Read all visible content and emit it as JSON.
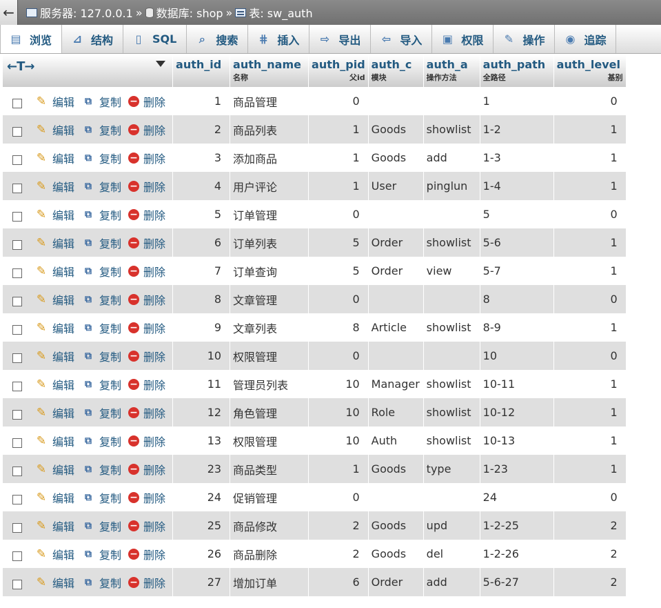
{
  "breadcrumb": {
    "back": "←",
    "server_label": "服务器: 127.0.0.1",
    "sep": "»",
    "db_label": "数据库: shop",
    "table_label": "表: sw_auth"
  },
  "tabs": [
    {
      "label": "浏览",
      "icon": "browse-icon",
      "glyph": "▤"
    },
    {
      "label": "结构",
      "icon": "structure-icon",
      "glyph": "⊿"
    },
    {
      "label": "SQL",
      "icon": "sql-icon",
      "glyph": "▯"
    },
    {
      "label": "搜索",
      "icon": "search-icon",
      "glyph": "⌕"
    },
    {
      "label": "插入",
      "icon": "insert-icon",
      "glyph": "⋕"
    },
    {
      "label": "导出",
      "icon": "export-icon",
      "glyph": "⇨"
    },
    {
      "label": "导入",
      "icon": "import-icon",
      "glyph": "⇦"
    },
    {
      "label": "权限",
      "icon": "privileges-icon",
      "glyph": "▣"
    },
    {
      "label": "操作",
      "icon": "operations-icon",
      "glyph": "✎"
    },
    {
      "label": "追踪",
      "icon": "tracking-icon",
      "glyph": "◉"
    }
  ],
  "table": {
    "arrows": "←T→",
    "columns": [
      {
        "name": "auth_id",
        "sub": ""
      },
      {
        "name": "auth_name",
        "sub": "名称"
      },
      {
        "name": "auth_pid",
        "sub": "父id"
      },
      {
        "name": "auth_c",
        "sub": "模块"
      },
      {
        "name": "auth_a",
        "sub": "操作方法"
      },
      {
        "name": "auth_path",
        "sub": "全路径"
      },
      {
        "name": "auth_level",
        "sub": "基别"
      }
    ],
    "actions": {
      "edit": "编辑",
      "copy": "复制",
      "delete": "删除"
    },
    "rows": [
      [
        "1",
        "商品管理",
        "0",
        "",
        "",
        "1",
        "0"
      ],
      [
        "2",
        "商品列表",
        "1",
        "Goods",
        "showlist",
        "1-2",
        "1"
      ],
      [
        "3",
        "添加商品",
        "1",
        "Goods",
        "add",
        "1-3",
        "1"
      ],
      [
        "4",
        "用户评论",
        "1",
        "User",
        "pinglun",
        "1-4",
        "1"
      ],
      [
        "5",
        "订单管理",
        "0",
        "",
        "",
        "5",
        "0"
      ],
      [
        "6",
        "订单列表",
        "5",
        "Order",
        "showlist",
        "5-6",
        "1"
      ],
      [
        "7",
        "订单查询",
        "5",
        "Order",
        "view",
        "5-7",
        "1"
      ],
      [
        "8",
        "文章管理",
        "0",
        "",
        "",
        "8",
        "0"
      ],
      [
        "9",
        "文章列表",
        "8",
        "Article",
        "showlist",
        "8-9",
        "1"
      ],
      [
        "10",
        "权限管理",
        "0",
        "",
        "",
        "10",
        "0"
      ],
      [
        "11",
        "管理员列表",
        "10",
        "Manager",
        "showlist",
        "10-11",
        "1"
      ],
      [
        "12",
        "角色管理",
        "10",
        "Role",
        "showlist",
        "10-12",
        "1"
      ],
      [
        "13",
        "权限管理",
        "10",
        "Auth",
        "showlist",
        "10-13",
        "1"
      ],
      [
        "23",
        "商品类型",
        "1",
        "Goods",
        "type",
        "1-23",
        "1"
      ],
      [
        "24",
        "促销管理",
        "0",
        "",
        "",
        "24",
        "0"
      ],
      [
        "25",
        "商品修改",
        "2",
        "Goods",
        "upd",
        "1-2-25",
        "2"
      ],
      [
        "26",
        "商品删除",
        "2",
        "Goods",
        "del",
        "1-2-26",
        "2"
      ],
      [
        "27",
        "增加订单",
        "6",
        "Order",
        "add",
        "5-6-27",
        "2"
      ]
    ]
  }
}
